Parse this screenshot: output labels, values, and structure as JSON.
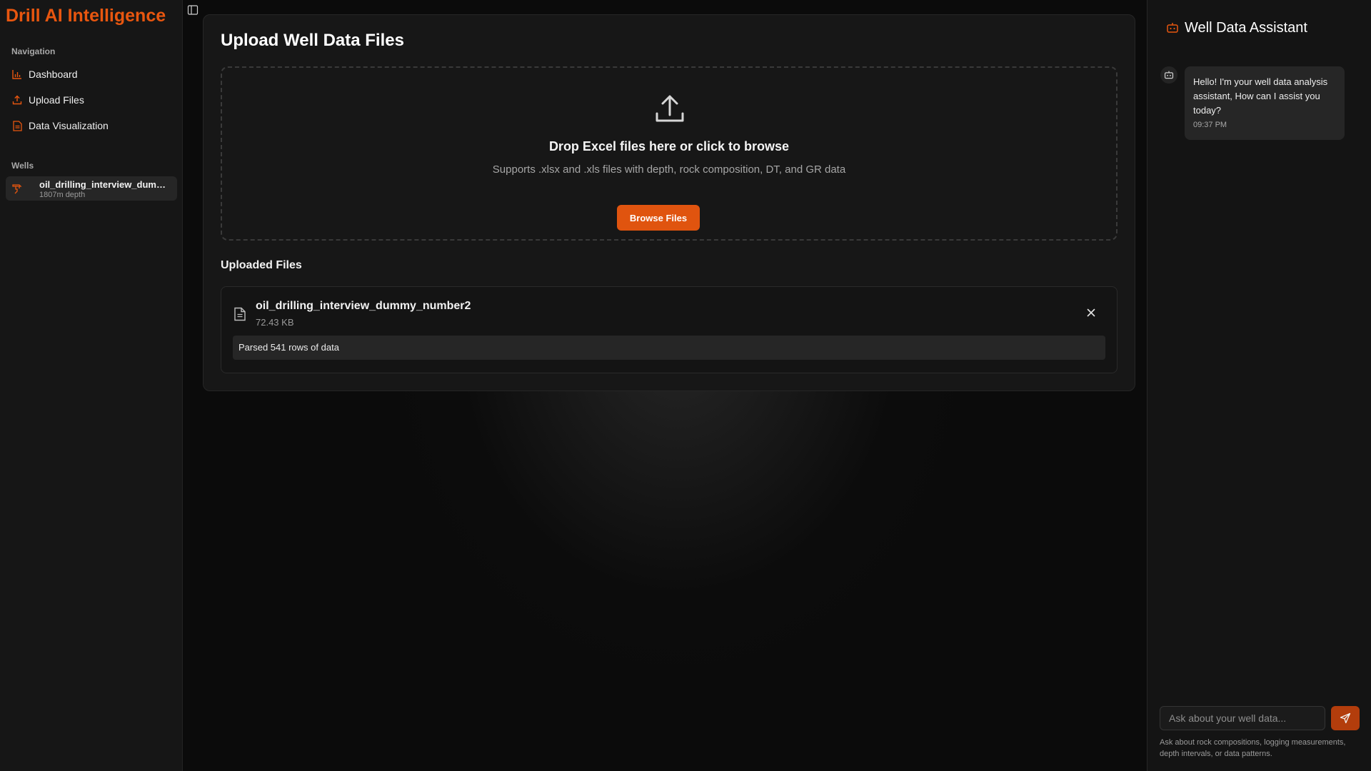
{
  "brand": {
    "title": "Drill AI Intelligence",
    "color": "#e8560f"
  },
  "sidebar": {
    "nav_label": "Navigation",
    "items": [
      {
        "label": "Dashboard",
        "icon": "bar-chart-icon"
      },
      {
        "label": "Upload Files",
        "icon": "upload-icon"
      },
      {
        "label": "Data Visualization",
        "icon": "file-icon"
      }
    ],
    "wells_label": "Wells",
    "wells": [
      {
        "name": "oil_drilling_interview_dummy_number2",
        "depth": "1807m depth",
        "icon": "drill-icon"
      }
    ]
  },
  "main": {
    "title": "Upload Well Data Files",
    "dropzone": {
      "title": "Drop Excel files here or click to browse",
      "subtitle": "Supports .xlsx and .xls files with depth, rock composition, DT, and GR data",
      "button": "Browse Files"
    },
    "uploaded_label": "Uploaded Files",
    "files": [
      {
        "name": "oil_drilling_interview_dummy_number2",
        "size": "72.43 KB",
        "status": "Parsed 541 rows of data"
      }
    ]
  },
  "chat": {
    "title": "Well Data Assistant",
    "messages": [
      {
        "text": "Hello! I'm your well data analysis assistant, How can I assist you today?",
        "time": "09:37 PM"
      }
    ],
    "input_placeholder": "Ask about your well data...",
    "hint": "Ask about rock compositions, logging measurements, depth intervals, or data patterns."
  },
  "colors": {
    "accent": "#e0540f",
    "send_button": "#b33d0c",
    "background": "#0b0b0b",
    "panel": "#171717"
  }
}
